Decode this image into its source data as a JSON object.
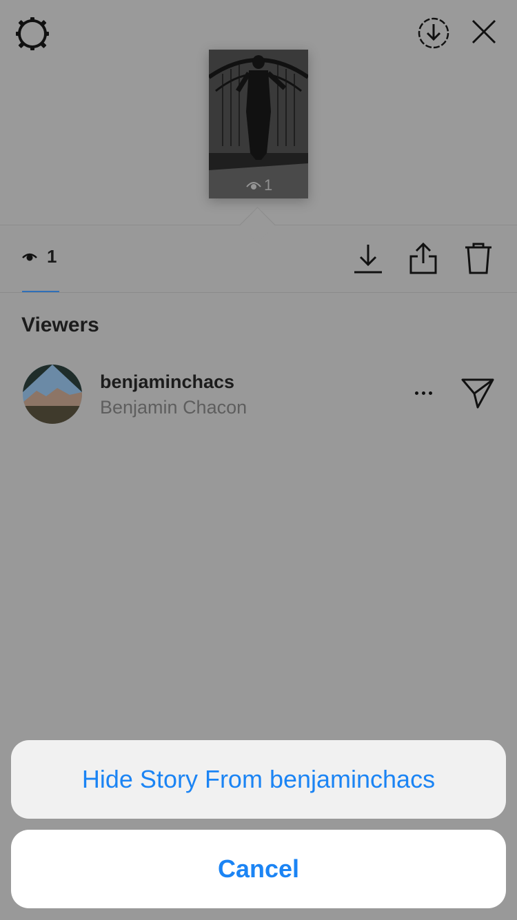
{
  "top_bar": {
    "settings_icon": "gear-icon",
    "save_icon": "download-circle-icon",
    "close_icon": "close-icon"
  },
  "story_thumbnail": {
    "views_count": "1"
  },
  "stats": {
    "views_count": "1",
    "download_icon": "download-icon",
    "share_icon": "share-icon",
    "delete_icon": "trash-icon"
  },
  "viewers": {
    "title": "Viewers",
    "items": [
      {
        "username": "benjaminchacs",
        "full_name": "Benjamin Chacon"
      }
    ]
  },
  "action_sheet": {
    "option_label": "Hide Story From benjaminchacs",
    "cancel_label": "Cancel"
  },
  "colors": {
    "dim_overlay": "#999999",
    "accent_blue": "#1b84f4",
    "tab_underline": "#2f6fb8"
  }
}
